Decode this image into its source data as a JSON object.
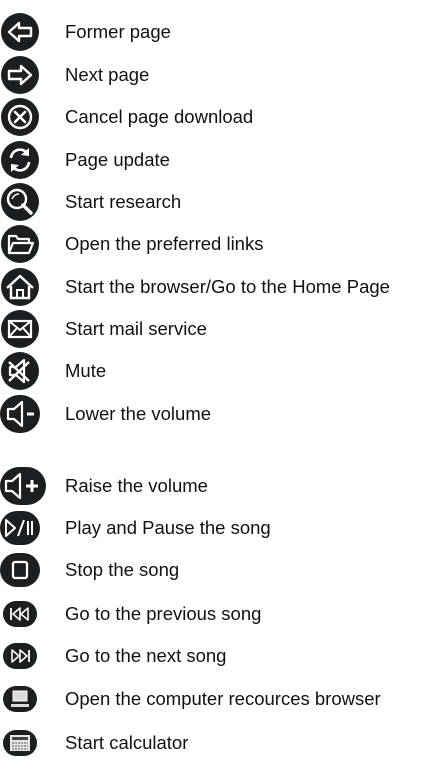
{
  "colors": {
    "icon_background": "#1c1f22",
    "icon_foreground": "#ffffff",
    "text": "#111111"
  },
  "items": [
    {
      "icon": "back-arrow-icon",
      "label": "Former page"
    },
    {
      "icon": "forward-arrow-icon",
      "label": "Next page"
    },
    {
      "icon": "cancel-icon",
      "label": "Cancel page download"
    },
    {
      "icon": "refresh-icon",
      "label": "Page update"
    },
    {
      "icon": "search-icon",
      "label": "Start research"
    },
    {
      "icon": "folder-icon",
      "label": "Open the preferred links"
    },
    {
      "icon": "home-icon",
      "label": "Start the browser/Go to the Home Page"
    },
    {
      "icon": "mail-icon",
      "label": "Start mail service"
    },
    {
      "icon": "mute-icon",
      "label": "Mute"
    },
    {
      "icon": "volume-down-icon",
      "label": "Lower the volume"
    },
    {
      "icon": "volume-up-icon",
      "label": "Raise the volume"
    },
    {
      "icon": "play-pause-icon",
      "label": "Play and Pause the song"
    },
    {
      "icon": "stop-icon",
      "label": "Stop the song"
    },
    {
      "icon": "previous-track-icon",
      "label": "Go to the previous song"
    },
    {
      "icon": "next-track-icon",
      "label": "Go to the next song"
    },
    {
      "icon": "computer-icon",
      "label": "Open the computer recources browser"
    },
    {
      "icon": "calculator-icon",
      "label": "Start calculator"
    }
  ]
}
